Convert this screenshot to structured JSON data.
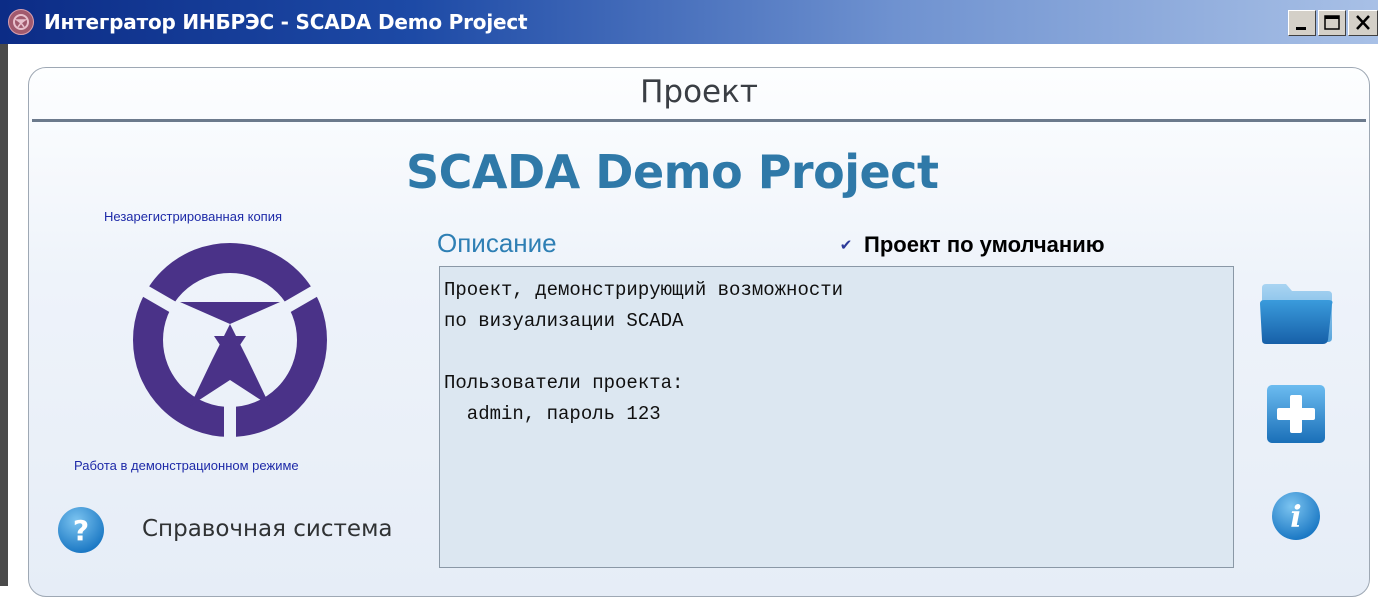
{
  "window": {
    "title": "Интегратор ИНБРЭС - SCADA Demo Project",
    "controls": [
      "minimize",
      "maximize",
      "close"
    ]
  },
  "panel": {
    "title": "Проект",
    "project_name": "SCADA Demo Project"
  },
  "left": {
    "unregistered_text": "Незарегистрированная копия",
    "demo_mode_text": "Работа в демонстрационном режиме",
    "help_label": "Справочная система"
  },
  "description": {
    "label": "Описание",
    "default_checkbox_label": "Проект по умолчанию",
    "default_checked": true,
    "text": "Проект, демонстрирующий возможности\nпо визуализации SCADA\n\nПользователи проекта:\n  admin, пароль 123"
  },
  "side_buttons": [
    "folder-icon",
    "add-icon",
    "info-icon"
  ],
  "colors": {
    "accent": "#2f79a8",
    "logo": "#4a3288",
    "title_bar_start": "#0c2c86",
    "title_bar_end": "#a8c0e6",
    "icon_blue": "#2e8ccc"
  }
}
